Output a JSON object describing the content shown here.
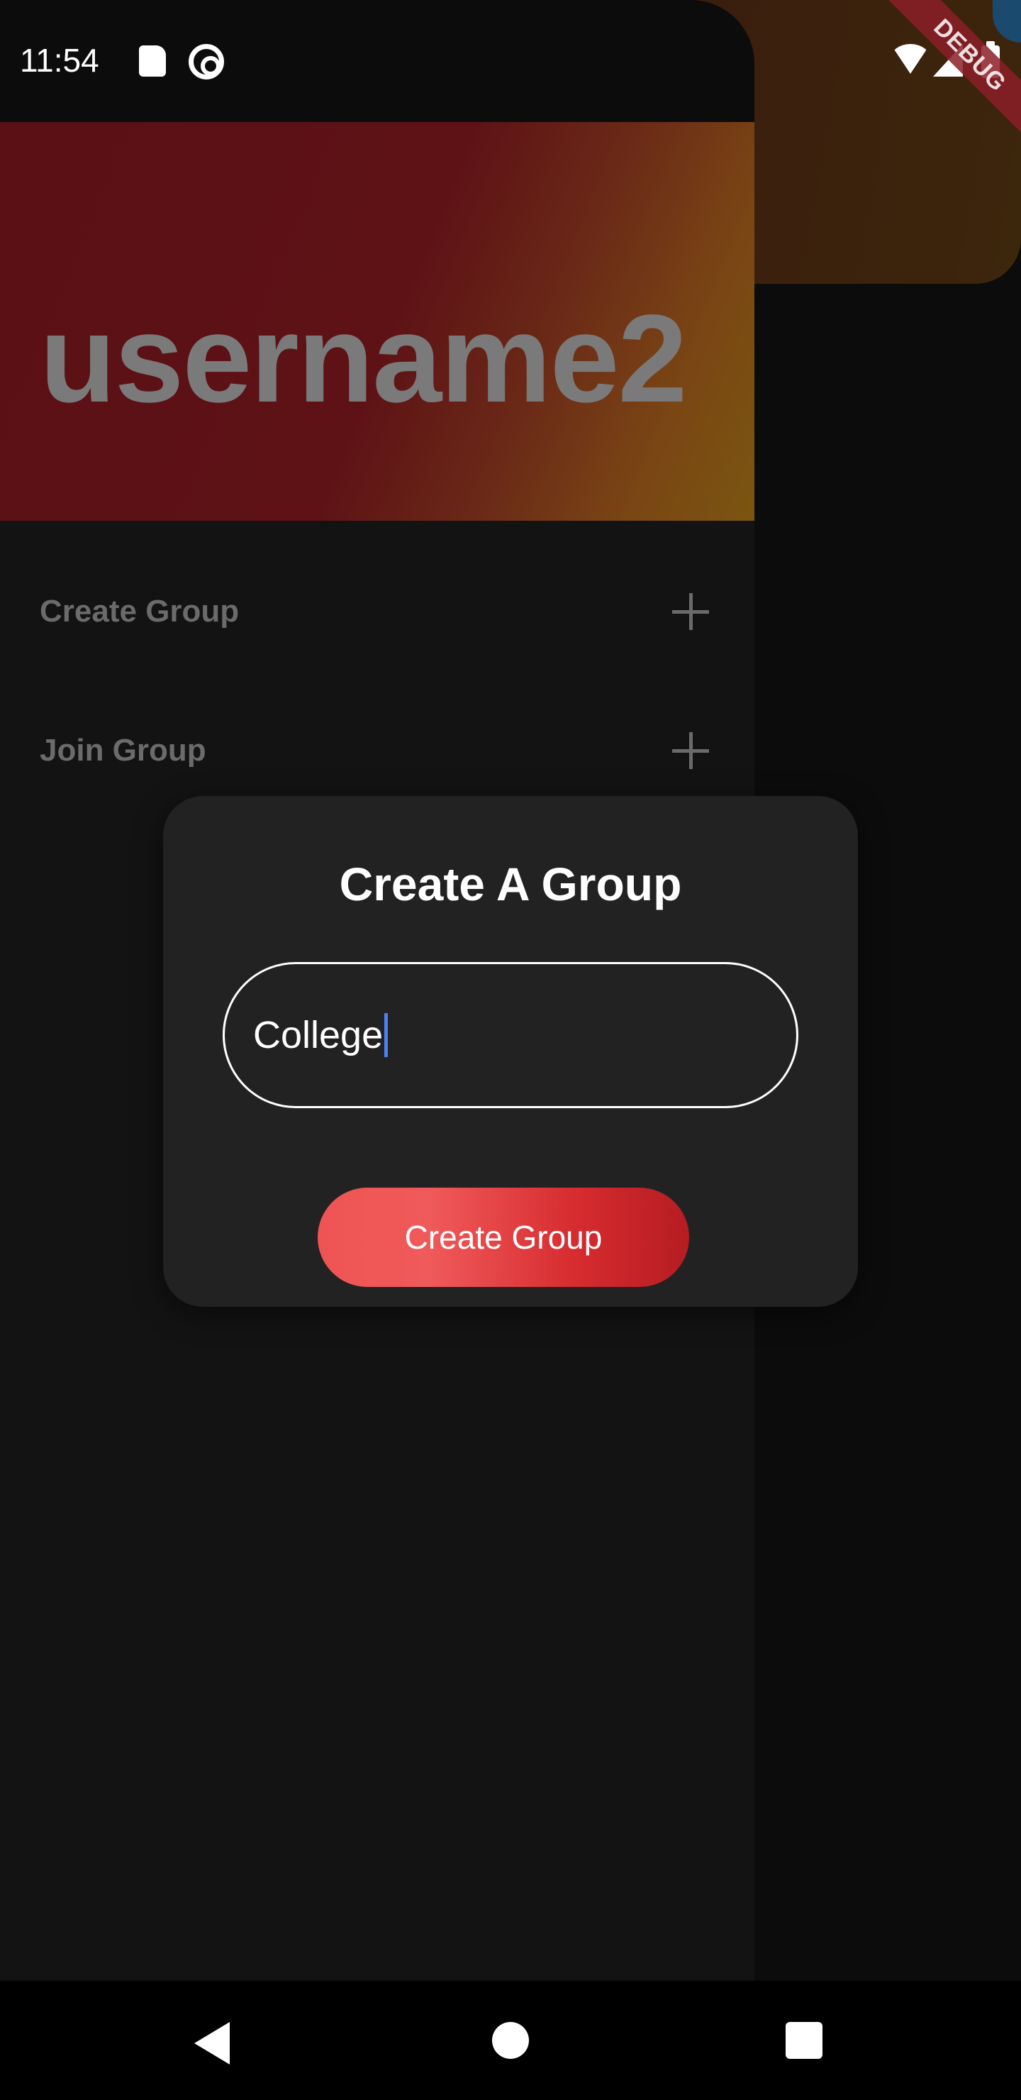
{
  "status_bar": {
    "time": "11:54",
    "icons": [
      "sd-card-icon",
      "sync-icon",
      "wifi-icon",
      "signal-icon",
      "battery-icon"
    ]
  },
  "debug_banner": "DEBUG",
  "drawer": {
    "username": "username2",
    "items": [
      {
        "label": "Create Group",
        "icon": "plus-icon"
      },
      {
        "label": "Join Group",
        "icon": "plus-icon"
      }
    ]
  },
  "dialog": {
    "title": "Create A Group",
    "input_value": "College",
    "button_label": "Create Group"
  },
  "nav_bar": {
    "icons": [
      "back-icon",
      "home-icon",
      "recents-icon"
    ]
  },
  "colors": {
    "accent_button_start": "#ef5454",
    "accent_button_end": "#b51d22",
    "caret": "#4a80f0",
    "dialog_bg": "#222222"
  }
}
